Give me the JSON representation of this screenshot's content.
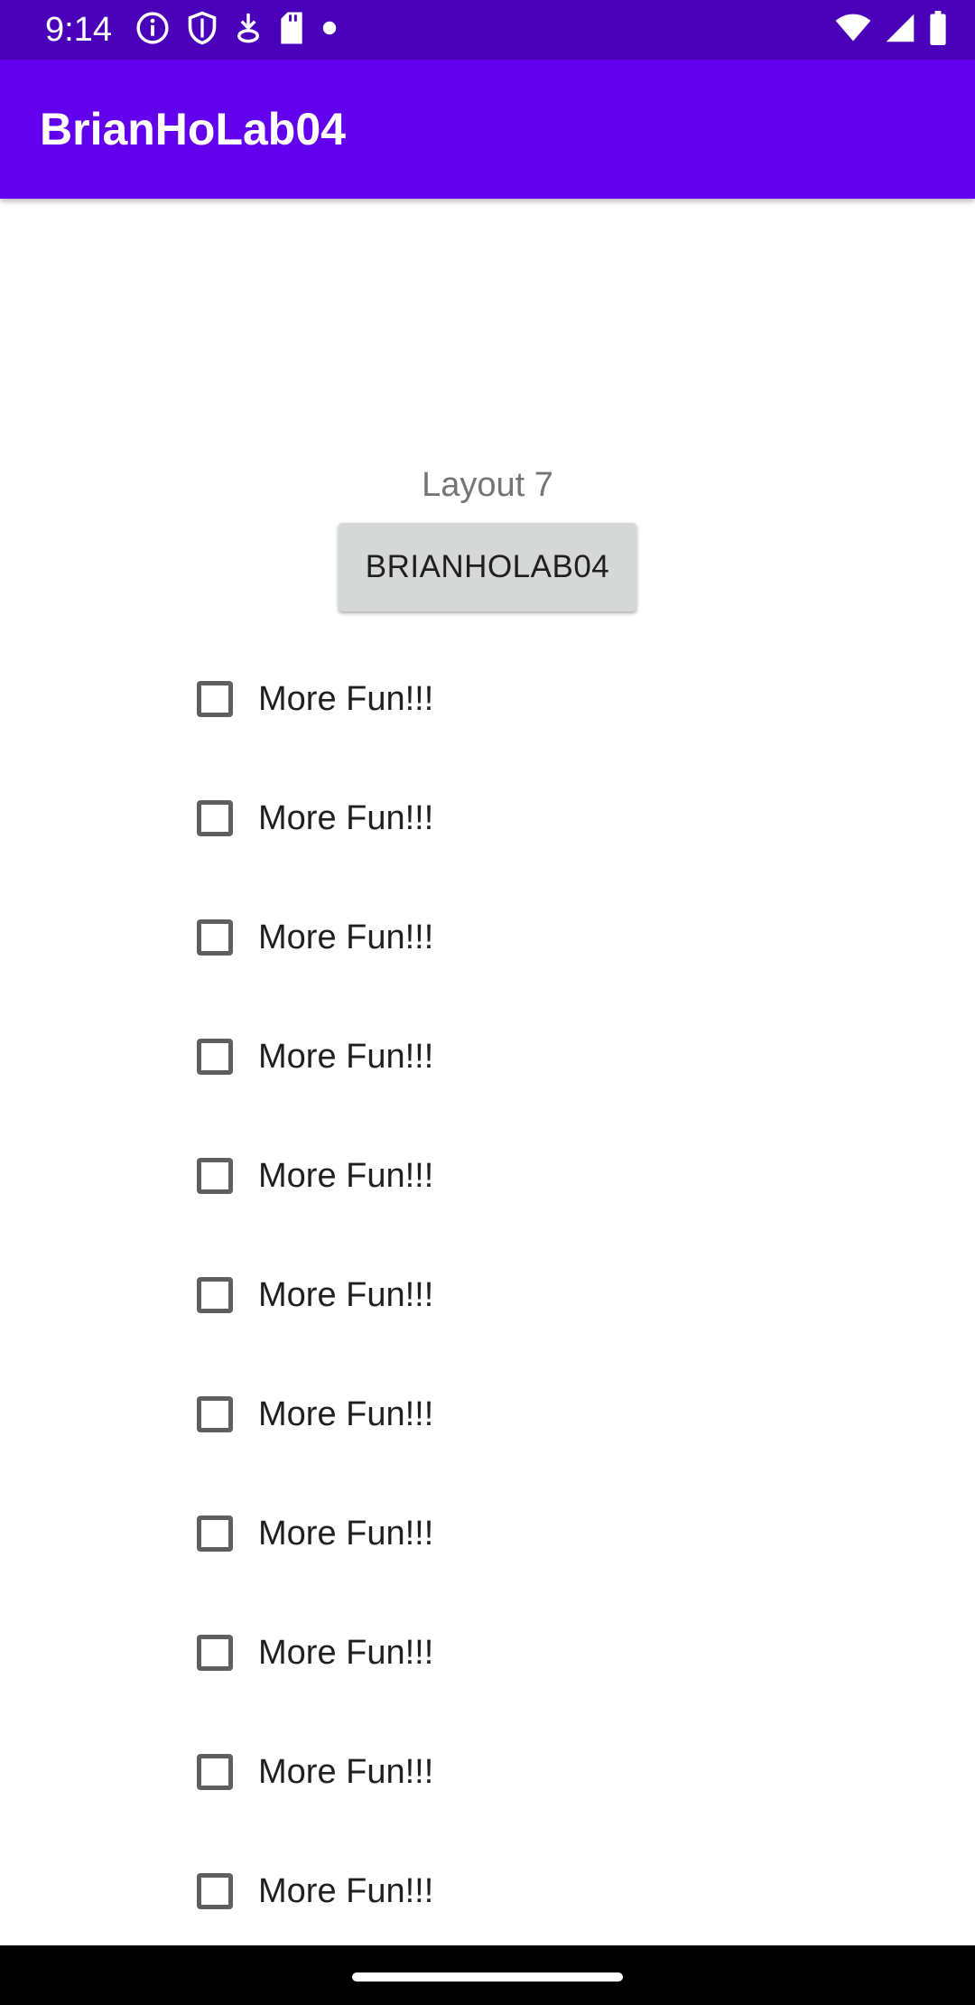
{
  "status_bar": {
    "time": "9:14",
    "left_icons": [
      "info-icon",
      "shield-icon",
      "download-icon",
      "sd-card-icon",
      "dot-icon"
    ],
    "right_icons": [
      "wifi-icon",
      "signal-icon",
      "battery-icon"
    ],
    "colors": {
      "background": "#4a00b8",
      "foreground": "#ffffff"
    }
  },
  "app_bar": {
    "title": "BrianHoLab04",
    "color": "#6200ee"
  },
  "main": {
    "layout_label": "Layout 7",
    "button_label": "BRIANHOLAB04",
    "checkboxes": [
      {
        "label": "More Fun!!!",
        "checked": false
      },
      {
        "label": "More Fun!!!",
        "checked": false
      },
      {
        "label": "More Fun!!!",
        "checked": false
      },
      {
        "label": "More Fun!!!",
        "checked": false
      },
      {
        "label": "More Fun!!!",
        "checked": false
      },
      {
        "label": "More Fun!!!",
        "checked": false
      },
      {
        "label": "More Fun!!!",
        "checked": false
      },
      {
        "label": "More Fun!!!",
        "checked": false
      },
      {
        "label": "More Fun!!!",
        "checked": false
      },
      {
        "label": "More Fun!!!",
        "checked": false
      },
      {
        "label": "More Fun!!!",
        "checked": false
      }
    ]
  },
  "nav_bar": {
    "icons": [
      "home-gesture-pill"
    ]
  }
}
